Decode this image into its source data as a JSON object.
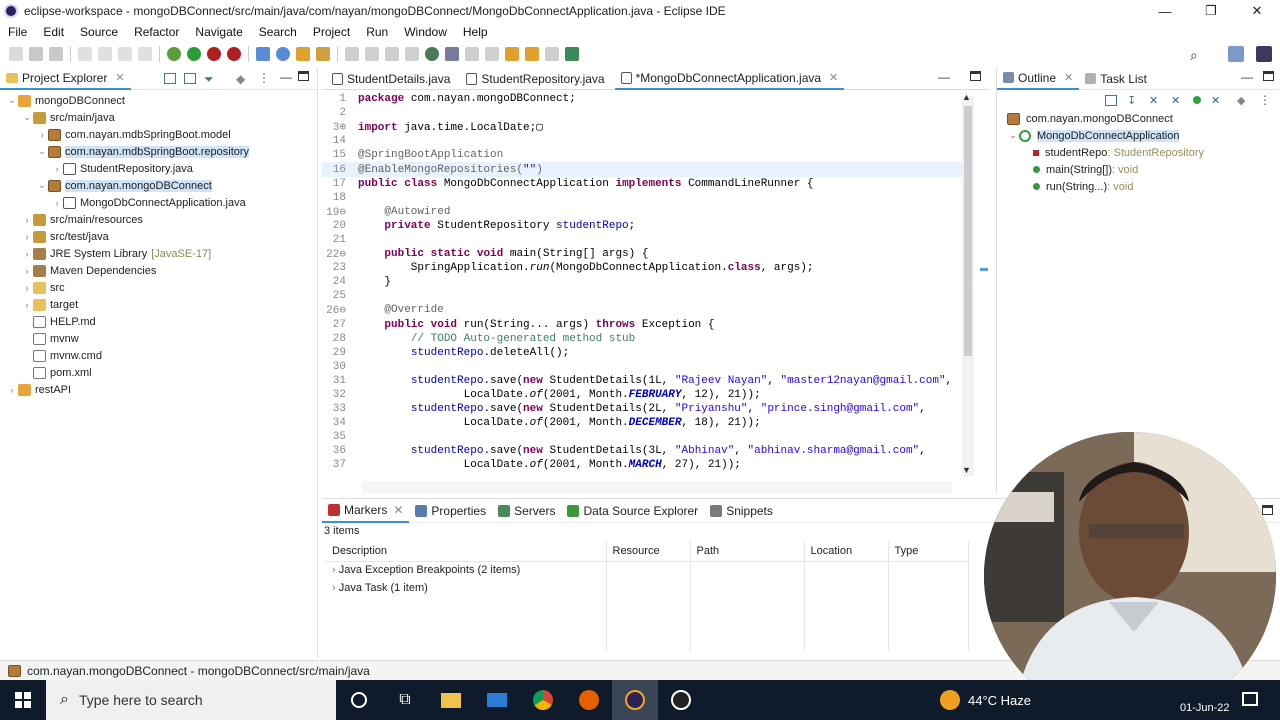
{
  "window": {
    "title": "eclipse-workspace - mongoDBConnect/src/main/java/com/nayan/mongoDBConnect/MongoDbConnectApplication.java - Eclipse IDE",
    "min": "—",
    "max": "❐",
    "close": "✕"
  },
  "menu": [
    "File",
    "Edit",
    "Source",
    "Refactor",
    "Navigate",
    "Search",
    "Project",
    "Run",
    "Window",
    "Help"
  ],
  "project_explorer": {
    "tab": "Project Explorer",
    "rows": [
      {
        "label": "mongoDBConnect",
        "indent": 0,
        "twisty": "⌄",
        "icon": "proj"
      },
      {
        "label": "src/main/java",
        "indent": 1,
        "twisty": "⌄",
        "icon": "src"
      },
      {
        "label": "com.nayan.mdbSpringBoot.model",
        "indent": 2,
        "twisty": "›",
        "icon": "pkg"
      },
      {
        "label": "com.nayan.mdbSpringBoot.repository",
        "indent": 2,
        "twisty": "⌄",
        "icon": "pkg",
        "selected": true
      },
      {
        "label": "StudentRepository.java",
        "indent": 3,
        "twisty": "›",
        "icon": "java"
      },
      {
        "label": "com.nayan.mongoDBConnect",
        "indent": 2,
        "twisty": "⌄",
        "icon": "pkg",
        "selected": true
      },
      {
        "label": "MongoDbConnectApplication.java",
        "indent": 3,
        "twisty": "›",
        "icon": "java"
      },
      {
        "label": "src/main/resources",
        "indent": 1,
        "twisty": "›",
        "icon": "src"
      },
      {
        "label": "src/test/java",
        "indent": 1,
        "twisty": "›",
        "icon": "src"
      },
      {
        "label": "JRE System Library",
        "hint": "[JavaSE-17]",
        "indent": 1,
        "twisty": "›",
        "icon": "lib"
      },
      {
        "label": "Maven Dependencies",
        "indent": 1,
        "twisty": "›",
        "icon": "lib"
      },
      {
        "label": "src",
        "indent": 1,
        "twisty": "›",
        "icon": "folder"
      },
      {
        "label": "target",
        "indent": 1,
        "twisty": "›",
        "icon": "folder"
      },
      {
        "label": "HELP.md",
        "indent": 1,
        "twisty": "",
        "icon": "md"
      },
      {
        "label": "mvnw",
        "indent": 1,
        "twisty": "",
        "icon": "file"
      },
      {
        "label": "mvnw.cmd",
        "indent": 1,
        "twisty": "",
        "icon": "file"
      },
      {
        "label": "pom.xml",
        "indent": 1,
        "twisty": "",
        "icon": "file"
      },
      {
        "label": "restAPI",
        "indent": 0,
        "twisty": "›",
        "icon": "proj"
      }
    ]
  },
  "editor": {
    "tabs": [
      {
        "label": "StudentDetails.java",
        "active": false
      },
      {
        "label": "StudentRepository.java",
        "active": false
      },
      {
        "label": "*MongoDbConnectApplication.java",
        "active": true
      }
    ],
    "lines": [
      {
        "n": "1",
        "html": "<span class='kw'>package</span> com.nayan.mongoDBConnect;"
      },
      {
        "n": "2",
        "html": ""
      },
      {
        "n": "3⊕",
        "html": "<span class='kw'>import</span> java.time.LocalDate;▢"
      },
      {
        "n": "14",
        "html": ""
      },
      {
        "n": "15",
        "html": "<span class='an'>@SpringBootApplication</span>"
      },
      {
        "n": "16",
        "html": "<span class='an'>@EnableMongoRepositories(</span><span class='str'>\"\"</span><span class='an'>)</span>",
        "current": true
      },
      {
        "n": "17",
        "html": "<span class='kw'>public</span> <span class='kw'>class</span> MongoDbConnectApplication <span class='kw'>implements</span> CommandLineRunner {"
      },
      {
        "n": "18",
        "html": ""
      },
      {
        "n": "19⊖",
        "html": "    <span class='an'>@Autowired</span>"
      },
      {
        "n": "20",
        "html": "    <span class='kw'>private</span> StudentRepository <span class='fld'>studentRepo</span>;"
      },
      {
        "n": "21",
        "html": ""
      },
      {
        "n": "22⊖",
        "html": "    <span class='kw'>public</span> <span class='kw'>static</span> <span class='kw'>void</span> main(String[] args) {"
      },
      {
        "n": "23",
        "html": "        SpringApplication.<span class='ita'>run</span>(MongoDbConnectApplication.<span class='kw'>class</span>, args);"
      },
      {
        "n": "24",
        "html": "    }"
      },
      {
        "n": "25",
        "html": ""
      },
      {
        "n": "26⊖",
        "html": "    <span class='an'>@Override</span>"
      },
      {
        "n": "27",
        "html": "    <span class='kw'>public</span> <span class='kw'>void</span> run(String... args) <span class='kw'>throws</span> Exception {"
      },
      {
        "n": "28",
        "html": "        <span class='cm'>// TODO Auto-generated method stub</span>"
      },
      {
        "n": "29",
        "html": "        <span class='fld'>studentRepo</span>.deleteAll();"
      },
      {
        "n": "30",
        "html": ""
      },
      {
        "n": "31",
        "html": "        <span class='fld'>studentRepo</span>.save(<span class='kw'>new</span> StudentDetails(1L, <span class='str'>\"Rajeev Nayan\"</span>, <span class='str'>\"master12nayan@gmail.com\"</span>,"
      },
      {
        "n": "32",
        "html": "                LocalDate.<span class='ita'>of</span>(2001, Month.<span class='itbf'>FEBRUARY</span>, 12), 21));"
      },
      {
        "n": "33",
        "html": "        <span class='fld'>studentRepo</span>.save(<span class='kw'>new</span> StudentDetails(2L, <span class='str'>\"Priyanshu\"</span>, <span class='str'>\"prince.singh@gmail.com\"</span>,"
      },
      {
        "n": "34",
        "html": "                LocalDate.<span class='ita'>of</span>(2001, Month.<span class='itbf'>DECEMBER</span>, 18), 21));"
      },
      {
        "n": "35",
        "html": ""
      },
      {
        "n": "36",
        "html": "        <span class='fld'>studentRepo</span>.save(<span class='kw'>new</span> StudentDetails(3L, <span class='str'>\"Abhinav\"</span>, <span class='str'>\"abhinav.sharma@gmail.com\"</span>,"
      },
      {
        "n": "37",
        "html": "                LocalDate.<span class='ita'>of</span>(2001, Month.<span class='itbf'>MARCH</span>, 27), 21));"
      }
    ]
  },
  "outline": {
    "tabs": [
      "Outline",
      "Task List"
    ],
    "rows": [
      {
        "label": "com.nayan.mongoDBConnect",
        "type": "",
        "indent": 0,
        "icon": "pkg"
      },
      {
        "label": "MongoDbConnectApplication",
        "type": "",
        "indent": 0,
        "icon": "class",
        "selected": true
      },
      {
        "label": "studentRepo",
        "type": " : StudentRepository",
        "indent": 1,
        "icon": "field"
      },
      {
        "label": "main(String[])",
        "type": " : void",
        "indent": 1,
        "icon": "method",
        "sup": "S"
      },
      {
        "label": "run(String...)",
        "type": " : void",
        "indent": 1,
        "icon": "method"
      }
    ]
  },
  "markers": {
    "tabs": [
      "Markers",
      "Properties",
      "Servers",
      "Data Source Explorer",
      "Snippets"
    ],
    "count": "3 items",
    "columns": [
      "Description",
      "Resource",
      "Path",
      "Location",
      "Type"
    ],
    "rows": [
      "Java Exception Breakpoints (2 items)",
      "Java Task (1 item)"
    ]
  },
  "status": "com.nayan.mongoDBConnect - mongoDBConnect/src/main/java",
  "taskbar": {
    "search_placeholder": "Type here to search",
    "weather": "44°C  Haze",
    "date": "01-Jun-22"
  },
  "colors": {
    "accent": "#3b8fd6",
    "taskbar": "#0f1b2a"
  }
}
